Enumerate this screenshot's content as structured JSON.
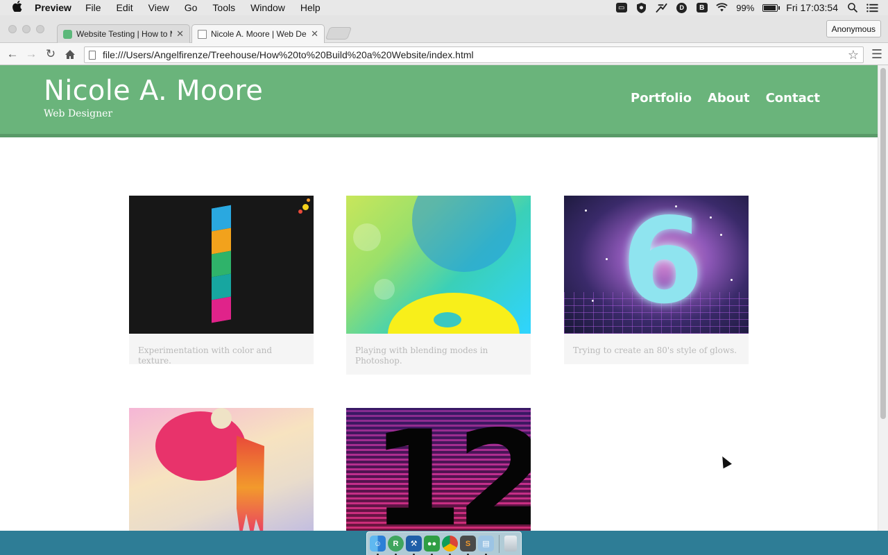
{
  "menubar": {
    "app_name": "Preview",
    "items": [
      "File",
      "Edit",
      "View",
      "Go",
      "Tools",
      "Window",
      "Help"
    ],
    "battery_percent": "99%",
    "battery_level": 0.99,
    "clock": "Fri 17:03:54",
    "tray_icons": [
      "caption-icon",
      "shield-icon",
      "network-tool-icon",
      "disk-icon",
      "b-app-icon",
      "wifi-icon",
      "battery-icon",
      "spotlight-icon",
      "notification-center-icon"
    ]
  },
  "browser": {
    "tabs": [
      {
        "title": "Website Testing | How to Ma",
        "icon": "treehouse-favicon",
        "active": false
      },
      {
        "title": "Nicole A. Moore | Web Desig",
        "icon": "document-favicon",
        "active": true
      }
    ],
    "profile_label": "Anonymous",
    "url": "file:///Users/Angelfirenze/Treehouse/How%20to%20Build%20a%20Website/index.html"
  },
  "site": {
    "title": "Nicole A. Moore",
    "subtitle": "Web Designer",
    "nav": [
      "Portfolio",
      "About",
      "Contact"
    ],
    "brand_color": "#6ab47b",
    "gallery": [
      {
        "caption": "Experimentation with color and texture.",
        "image": "numeral-1-stripes"
      },
      {
        "caption": "Playing with blending modes in Photoshop.",
        "image": "numeral-2-gradient"
      },
      {
        "caption": "Trying to create an 80's style of glows.",
        "image": "numeral-6-glow"
      },
      {
        "caption": "",
        "image": "numeral-9-drip"
      },
      {
        "caption": "",
        "image": "numeral-12-lines"
      }
    ]
  },
  "dock": {
    "apps": [
      "finder",
      "reeder",
      "xcode",
      "roboform",
      "chrome",
      "sublime-text",
      "preview",
      "trash"
    ]
  }
}
